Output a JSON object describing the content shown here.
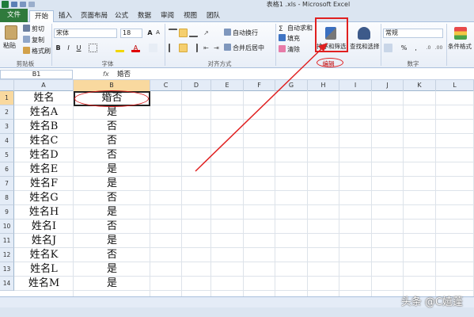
{
  "window": {
    "title": "表格1 .xls - Microsoft Excel"
  },
  "tabs": [
    "文件",
    "开始",
    "插入",
    "页面布局",
    "公式",
    "数据",
    "审阅",
    "视图",
    "团队"
  ],
  "ribbon": {
    "clipboard": {
      "paste": "粘贴",
      "cut": "剪切",
      "copy": "复制",
      "format_painter": "格式刷",
      "label": "剪贴板"
    },
    "font": {
      "name": "宋体",
      "size": "18",
      "bold": "B",
      "italic": "I",
      "underline": "U",
      "font_color_glyph": "A",
      "label": "字体"
    },
    "alignment": {
      "wrap": "自动换行",
      "merge": "合并后居中",
      "label": "对齐方式"
    },
    "editing": {
      "autosum": "自动求和",
      "fill": "填充",
      "clear": "清除",
      "sort_filter": "排序和筛选",
      "find_select": "查找和选择",
      "label": "编辑"
    },
    "number": {
      "format": "常规",
      "percent": "%",
      "comma": ",",
      "label": "数字"
    },
    "styles": {
      "conditional": "条件格式"
    }
  },
  "formula_bar": {
    "name_box": "B1",
    "fx": "fx",
    "value": "婚否"
  },
  "columns": [
    "A",
    "B",
    "C",
    "D",
    "E",
    "F",
    "G",
    "H",
    "I",
    "J",
    "K",
    "L"
  ],
  "rows": [
    {
      "num": "1",
      "a": "姓名",
      "b": "婚否"
    },
    {
      "num": "2",
      "a": "姓名A",
      "b": "是"
    },
    {
      "num": "3",
      "a": "姓名B",
      "b": "否"
    },
    {
      "num": "4",
      "a": "姓名C",
      "b": "否"
    },
    {
      "num": "5",
      "a": "姓名D",
      "b": "否"
    },
    {
      "num": "6",
      "a": "姓名E",
      "b": "是"
    },
    {
      "num": "7",
      "a": "姓名F",
      "b": "是"
    },
    {
      "num": "8",
      "a": "姓名G",
      "b": "否"
    },
    {
      "num": "9",
      "a": "姓名H",
      "b": "是"
    },
    {
      "num": "10",
      "a": "姓名I",
      "b": "否"
    },
    {
      "num": "11",
      "a": "姓名J",
      "b": "是"
    },
    {
      "num": "12",
      "a": "姓名K",
      "b": "否"
    },
    {
      "num": "13",
      "a": "姓名L",
      "b": "是"
    },
    {
      "num": "14",
      "a": "姓名M",
      "b": "是"
    }
  ],
  "watermark": "头条 @C嬉蓬",
  "colors": {
    "accent": "#e02020",
    "file_tab": "#2f7a3c",
    "header_selected": "#f9d99f"
  }
}
